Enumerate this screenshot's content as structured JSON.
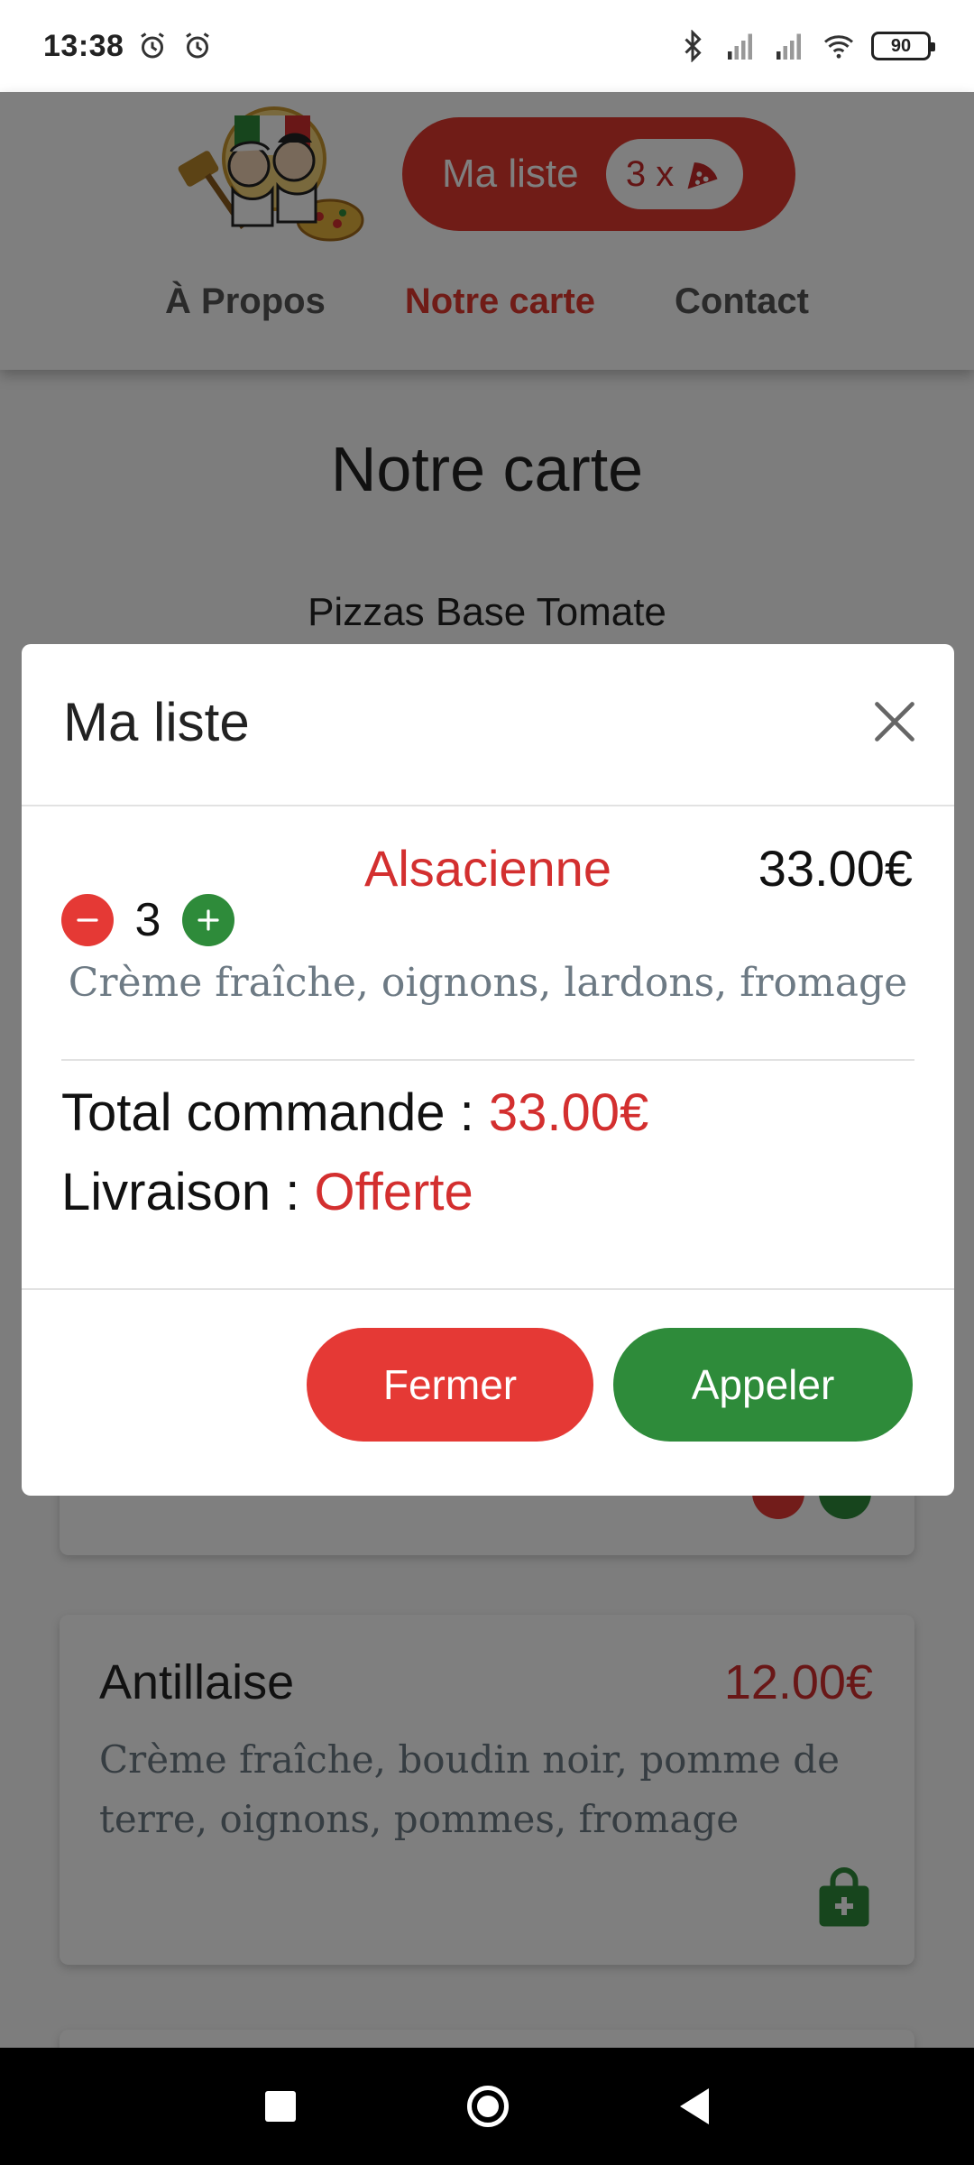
{
  "status_bar": {
    "time": "13:38",
    "battery": "90",
    "icons": [
      "alarm-icon",
      "alarm-icon",
      "bluetooth-icon",
      "signal-icon",
      "signal-icon",
      "wifi-icon",
      "battery-icon"
    ]
  },
  "header": {
    "cart_label": "Ma liste",
    "cart_count": "3 x",
    "nav": [
      {
        "label": "À Propos",
        "active": false
      },
      {
        "label": "Notre carte",
        "active": true
      },
      {
        "label": "Contact",
        "active": false
      }
    ]
  },
  "page": {
    "title": "Notre carte",
    "section": "Pizzas Base Tomate",
    "cards": [
      {
        "name": "Antillaise",
        "price": "12.00€",
        "description": "Crème fraîche, boudin noir, pomme de terre, oignons, pommes, fromage"
      }
    ]
  },
  "modal": {
    "title": "Ma liste",
    "item": {
      "quantity": "3",
      "name": "Alsacienne",
      "price": "33.00€",
      "description": "Crème fraîche, oignons, lardons, fromage"
    },
    "total_label": "Total commande :",
    "total_value": "33.00€",
    "delivery_label": "Livraison :",
    "delivery_value": "Offerte",
    "close_button": "Fermer",
    "call_button": "Appeler"
  },
  "colors": {
    "accent_red": "#e0382e",
    "price_red": "#d32f2f",
    "green": "#2e8b3a"
  }
}
